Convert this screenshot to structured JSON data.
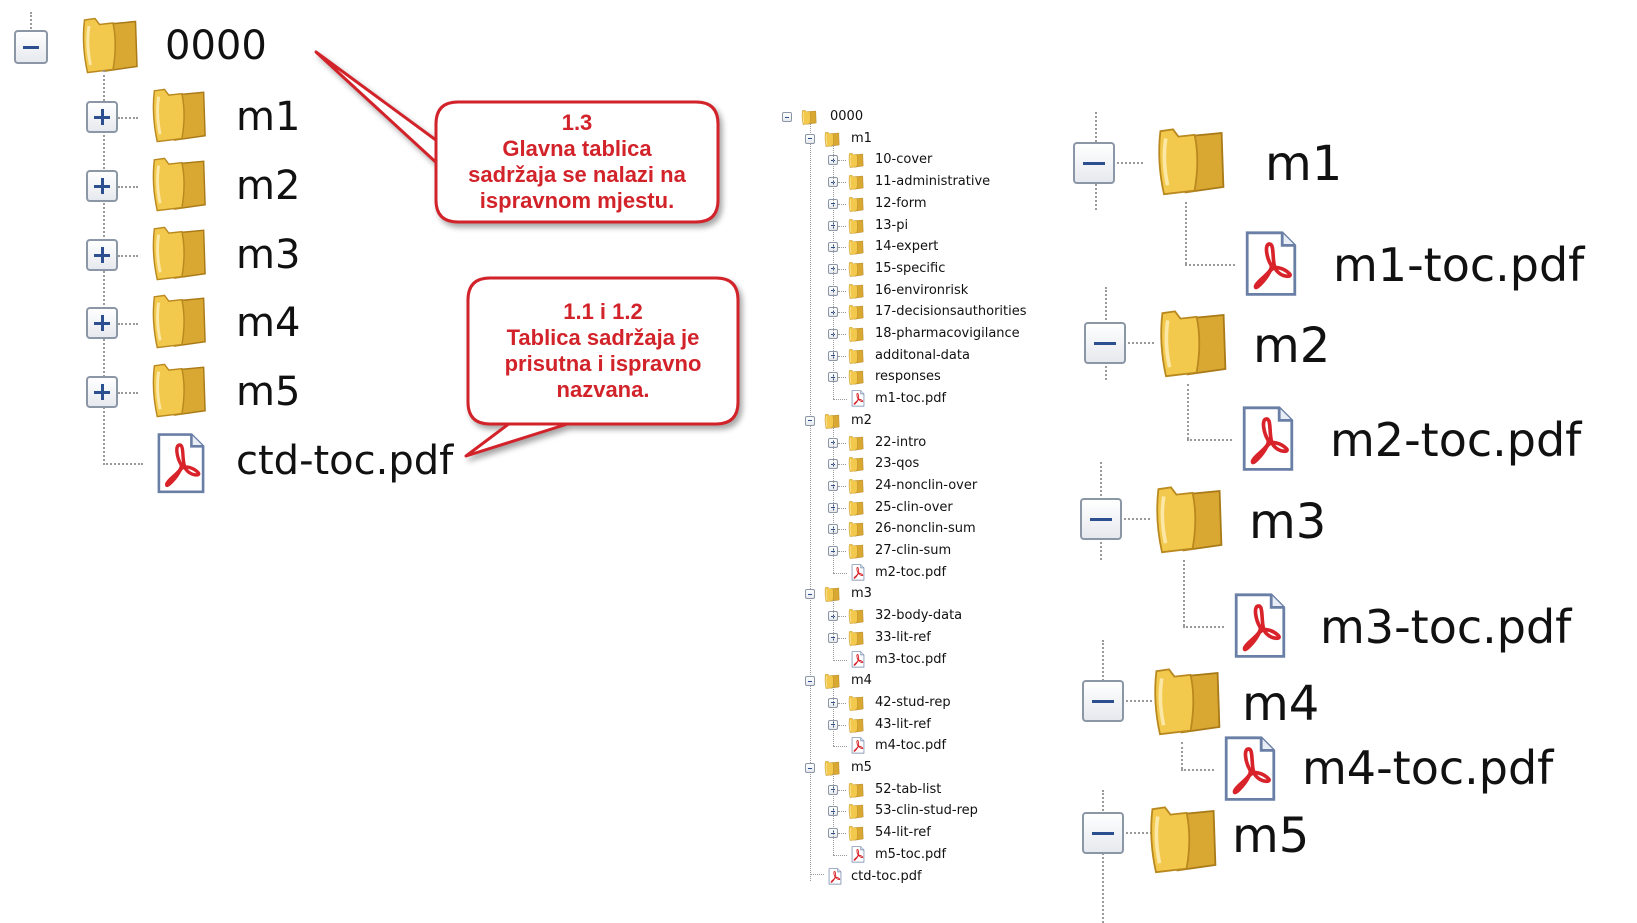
{
  "colors": {
    "callout_border": "#d2232a",
    "callout_text": "#d2232a",
    "folder": "#f2c94c",
    "pdf_icon": "#d8232a",
    "toggle_sign": "#2c4f8f"
  },
  "icons": {
    "folder": "folder-icon",
    "pdf": "pdf-icon",
    "expand": "plus-box-icon",
    "collapse": "minus-box-icon"
  },
  "left_tree": {
    "root": "0000",
    "folders": [
      "m1",
      "m2",
      "m3",
      "m4",
      "m5"
    ],
    "file": "ctd-toc.pdf"
  },
  "callouts": [
    {
      "lines": [
        "1.3",
        "Glavna tablica",
        "sadržaja se nalazi na",
        "ispravnom mjestu."
      ]
    },
    {
      "lines": [
        "1.1 i 1.2",
        "Tablica sadržaja je",
        "prisutna i ispravno",
        "nazvana."
      ]
    }
  ],
  "middle_tree": {
    "root": "0000",
    "modules": [
      {
        "name": "m1",
        "items": [
          "10-cover",
          "11-administrative",
          "12-form",
          "13-pi",
          "14-expert",
          "15-specific",
          "16-environrisk",
          "17-decisionsauthorities",
          "18-pharmacovigilance",
          "additonal-data",
          "responses"
        ],
        "file": "m1-toc.pdf"
      },
      {
        "name": "m2",
        "items": [
          "22-intro",
          "23-qos",
          "24-nonclin-over",
          "25-clin-over",
          "26-nonclin-sum",
          "27-clin-sum"
        ],
        "file": "m2-toc.pdf"
      },
      {
        "name": "m3",
        "items": [
          "32-body-data",
          "33-lit-ref"
        ],
        "file": "m3-toc.pdf"
      },
      {
        "name": "m4",
        "items": [
          "42-stud-rep",
          "43-lit-ref"
        ],
        "file": "m4-toc.pdf"
      },
      {
        "name": "m5",
        "items": [
          "52-tab-list",
          "53-clin-stud-rep",
          "54-lit-ref"
        ],
        "file": "m5-toc.pdf"
      }
    ],
    "file": "ctd-toc.pdf"
  },
  "right_tree": {
    "modules": [
      {
        "name": "m1",
        "file": "m1-toc.pdf"
      },
      {
        "name": "m2",
        "file": "m2-toc.pdf"
      },
      {
        "name": "m3",
        "file": "m3-toc.pdf"
      },
      {
        "name": "m4",
        "file": "m4-toc.pdf"
      },
      {
        "name": "m5"
      }
    ]
  }
}
